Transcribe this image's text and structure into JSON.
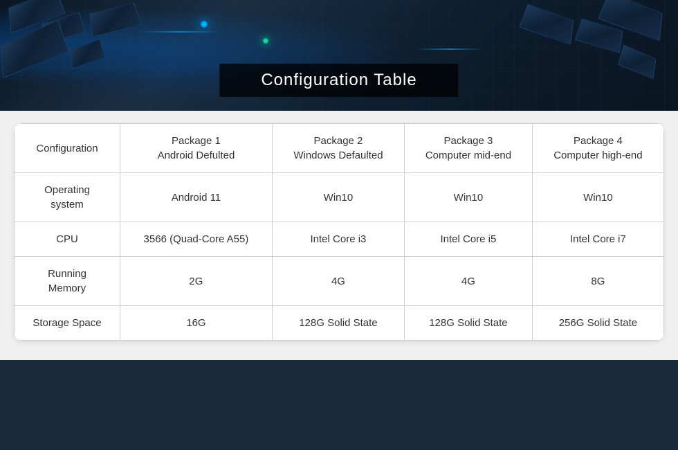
{
  "hero": {
    "title": "Configuration Table"
  },
  "table": {
    "headers": {
      "col0": "Configuration",
      "col1_line1": "Package 1",
      "col1_line2": "Android Defulted",
      "col2_line1": "Package 2",
      "col2_line2": "Windows Defaulted",
      "col3_line1": "Package 3",
      "col3_line2": "Computer mid-end",
      "col4_line1": "Package 4",
      "col4_line2": "Computer high-end"
    },
    "rows": [
      {
        "label_line1": "Operating",
        "label_line2": "system",
        "val1": "Android 11",
        "val2": "Win10",
        "val3": "Win10",
        "val4": "Win10"
      },
      {
        "label": "CPU",
        "val1": "3566 (Quad-Core A55)",
        "val2": "Intel Core i3",
        "val3": "Intel Core i5",
        "val4": "Intel Core i7"
      },
      {
        "label_line1": "Running",
        "label_line2": "Memory",
        "val1": "2G",
        "val2": "4G",
        "val3": "4G",
        "val4": "8G"
      },
      {
        "label": "Storage Space",
        "val1": "16G",
        "val2": "128G Solid State",
        "val3": "128G Solid State",
        "val4": "256G Solid State"
      }
    ]
  }
}
